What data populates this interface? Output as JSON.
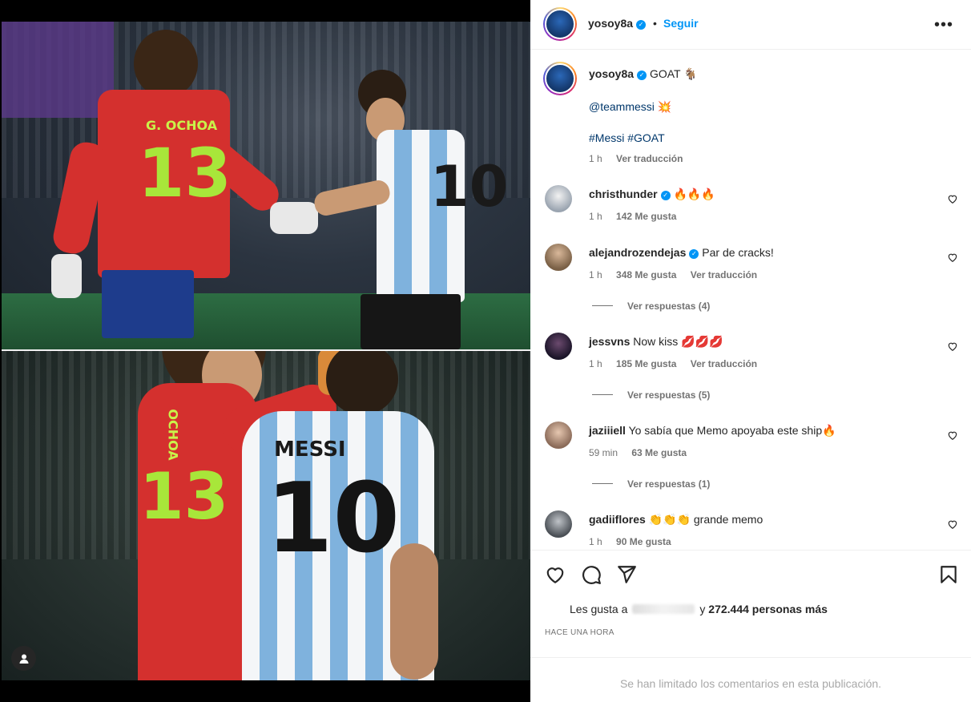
{
  "post_header": {
    "username": "yosoy8a",
    "separator": "•",
    "follow_label": "Seguir",
    "more_icon": "ellipsis-icon"
  },
  "caption": {
    "username": "yosoy8a",
    "text": "GOAT 🐐",
    "mention": "@teammessi",
    "mention_emoji": "💥",
    "hashtags": "#Messi #GOAT",
    "time": "1 h",
    "translate": "Ver traducción"
  },
  "comments": [
    {
      "username": "christhunder",
      "verified": true,
      "text": "🔥🔥🔥",
      "time": "1 h",
      "likes": "142 Me gusta",
      "translate": "",
      "replies": ""
    },
    {
      "username": "alejandrozendejas",
      "verified": true,
      "text": "Par de cracks!",
      "time": "1 h",
      "likes": "348 Me gusta",
      "translate": "Ver traducción",
      "replies": "Ver respuestas (4)"
    },
    {
      "username": "jessvns",
      "verified": false,
      "text": "Now kiss 💋💋💋",
      "time": "1 h",
      "likes": "185 Me gusta",
      "translate": "Ver traducción",
      "replies": "Ver respuestas (5)"
    },
    {
      "username": "jaziiiell",
      "verified": false,
      "text": "Yo sabía que Memo apoyaba este ship🔥",
      "time": "59 min",
      "likes": "63 Me gusta",
      "translate": "",
      "replies": "Ver respuestas (1)"
    },
    {
      "username": "gadiiflores",
      "verified": false,
      "text": "👏👏👏 grande memo",
      "time": "1 h",
      "likes": "90 Me gusta",
      "translate": "",
      "replies": ""
    }
  ],
  "actions": {
    "like_icon": "heart-icon",
    "comment_icon": "comment-icon",
    "share_icon": "share-icon",
    "save_icon": "bookmark-icon"
  },
  "likes_summary": {
    "prefix": "Les gusta a",
    "suffix": "y",
    "count": "272.444 personas más"
  },
  "timestamp": "HACE UNA HORA",
  "comments_limited": "Se han limitado los comentarios en esta publicación.",
  "photo": {
    "top_jersey_name": "G. OCHOA",
    "top_jersey_number": "13",
    "top_messi_number": "10",
    "bottom_ochoa_name": "OCHOA",
    "bottom_ochoa_number": "13",
    "bottom_messi_name": "MESSI",
    "bottom_messi_number": "10"
  },
  "colors": {
    "accent_blue": "#0095f6",
    "link_blue": "#00376b",
    "mexico_red": "#d4302e",
    "argentina_sky": "#7fb2dd"
  }
}
